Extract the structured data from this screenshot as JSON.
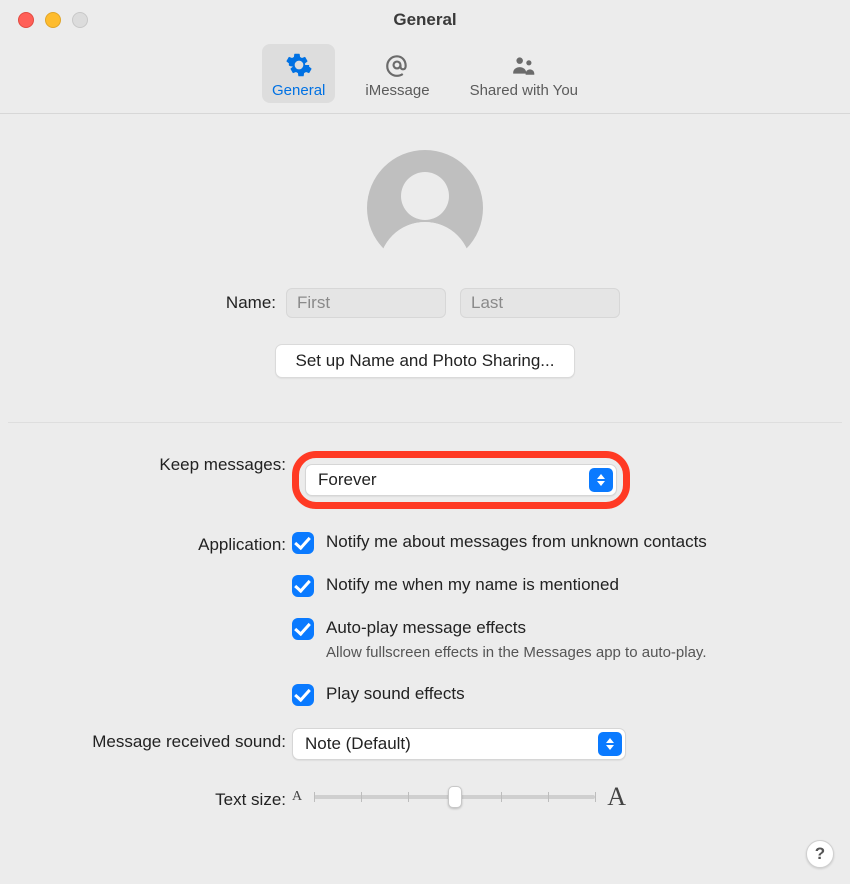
{
  "window": {
    "title": "General"
  },
  "toolbar": {
    "items": [
      {
        "label": "General"
      },
      {
        "label": "iMessage"
      },
      {
        "label": "Shared with You"
      }
    ]
  },
  "identity": {
    "name_label": "Name:",
    "first_placeholder": "First",
    "last_placeholder": "Last",
    "setup_button": "Set up Name and Photo Sharing..."
  },
  "settings": {
    "keep_messages": {
      "label": "Keep messages:",
      "value": "Forever"
    },
    "application": {
      "label": "Application:",
      "items": [
        {
          "label": "Notify me about messages from unknown contacts",
          "sub": ""
        },
        {
          "label": "Notify me when my name is mentioned",
          "sub": ""
        },
        {
          "label": "Auto-play message effects",
          "sub": "Allow fullscreen effects in the Messages app to auto-play."
        },
        {
          "label": "Play sound effects",
          "sub": ""
        }
      ]
    },
    "sound": {
      "label": "Message received sound:",
      "value": "Note (Default)"
    },
    "text_size": {
      "label": "Text size:",
      "small": "A",
      "big": "A"
    }
  },
  "help": "?"
}
